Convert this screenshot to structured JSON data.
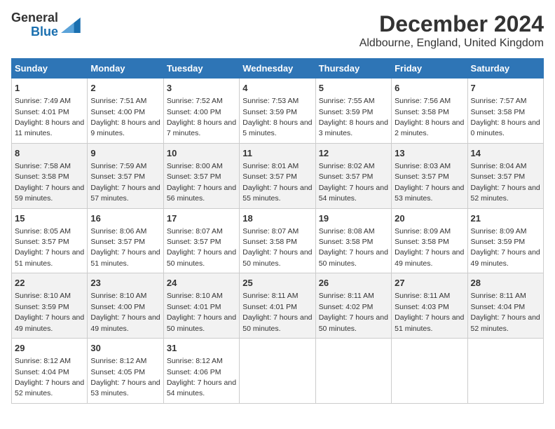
{
  "logo": {
    "general": "General",
    "blue": "Blue"
  },
  "title": "December 2024",
  "subtitle": "Aldbourne, England, United Kingdom",
  "days_of_week": [
    "Sunday",
    "Monday",
    "Tuesday",
    "Wednesday",
    "Thursday",
    "Friday",
    "Saturday"
  ],
  "weeks": [
    [
      {
        "day": "1",
        "sunrise": "7:49 AM",
        "sunset": "4:01 PM",
        "daylight": "8 hours and 11 minutes."
      },
      {
        "day": "2",
        "sunrise": "7:51 AM",
        "sunset": "4:00 PM",
        "daylight": "8 hours and 9 minutes."
      },
      {
        "day": "3",
        "sunrise": "7:52 AM",
        "sunset": "4:00 PM",
        "daylight": "8 hours and 7 minutes."
      },
      {
        "day": "4",
        "sunrise": "7:53 AM",
        "sunset": "3:59 PM",
        "daylight": "8 hours and 5 minutes."
      },
      {
        "day": "5",
        "sunrise": "7:55 AM",
        "sunset": "3:59 PM",
        "daylight": "8 hours and 3 minutes."
      },
      {
        "day": "6",
        "sunrise": "7:56 AM",
        "sunset": "3:58 PM",
        "daylight": "8 hours and 2 minutes."
      },
      {
        "day": "7",
        "sunrise": "7:57 AM",
        "sunset": "3:58 PM",
        "daylight": "8 hours and 0 minutes."
      }
    ],
    [
      {
        "day": "8",
        "sunrise": "7:58 AM",
        "sunset": "3:58 PM",
        "daylight": "7 hours and 59 minutes."
      },
      {
        "day": "9",
        "sunrise": "7:59 AM",
        "sunset": "3:57 PM",
        "daylight": "7 hours and 57 minutes."
      },
      {
        "day": "10",
        "sunrise": "8:00 AM",
        "sunset": "3:57 PM",
        "daylight": "7 hours and 56 minutes."
      },
      {
        "day": "11",
        "sunrise": "8:01 AM",
        "sunset": "3:57 PM",
        "daylight": "7 hours and 55 minutes."
      },
      {
        "day": "12",
        "sunrise": "8:02 AM",
        "sunset": "3:57 PM",
        "daylight": "7 hours and 54 minutes."
      },
      {
        "day": "13",
        "sunrise": "8:03 AM",
        "sunset": "3:57 PM",
        "daylight": "7 hours and 53 minutes."
      },
      {
        "day": "14",
        "sunrise": "8:04 AM",
        "sunset": "3:57 PM",
        "daylight": "7 hours and 52 minutes."
      }
    ],
    [
      {
        "day": "15",
        "sunrise": "8:05 AM",
        "sunset": "3:57 PM",
        "daylight": "7 hours and 51 minutes."
      },
      {
        "day": "16",
        "sunrise": "8:06 AM",
        "sunset": "3:57 PM",
        "daylight": "7 hours and 51 minutes."
      },
      {
        "day": "17",
        "sunrise": "8:07 AM",
        "sunset": "3:57 PM",
        "daylight": "7 hours and 50 minutes."
      },
      {
        "day": "18",
        "sunrise": "8:07 AM",
        "sunset": "3:58 PM",
        "daylight": "7 hours and 50 minutes."
      },
      {
        "day": "19",
        "sunrise": "8:08 AM",
        "sunset": "3:58 PM",
        "daylight": "7 hours and 50 minutes."
      },
      {
        "day": "20",
        "sunrise": "8:09 AM",
        "sunset": "3:58 PM",
        "daylight": "7 hours and 49 minutes."
      },
      {
        "day": "21",
        "sunrise": "8:09 AM",
        "sunset": "3:59 PM",
        "daylight": "7 hours and 49 minutes."
      }
    ],
    [
      {
        "day": "22",
        "sunrise": "8:10 AM",
        "sunset": "3:59 PM",
        "daylight": "7 hours and 49 minutes."
      },
      {
        "day": "23",
        "sunrise": "8:10 AM",
        "sunset": "4:00 PM",
        "daylight": "7 hours and 49 minutes."
      },
      {
        "day": "24",
        "sunrise": "8:10 AM",
        "sunset": "4:01 PM",
        "daylight": "7 hours and 50 minutes."
      },
      {
        "day": "25",
        "sunrise": "8:11 AM",
        "sunset": "4:01 PM",
        "daylight": "7 hours and 50 minutes."
      },
      {
        "day": "26",
        "sunrise": "8:11 AM",
        "sunset": "4:02 PM",
        "daylight": "7 hours and 50 minutes."
      },
      {
        "day": "27",
        "sunrise": "8:11 AM",
        "sunset": "4:03 PM",
        "daylight": "7 hours and 51 minutes."
      },
      {
        "day": "28",
        "sunrise": "8:11 AM",
        "sunset": "4:04 PM",
        "daylight": "7 hours and 52 minutes."
      }
    ],
    [
      {
        "day": "29",
        "sunrise": "8:12 AM",
        "sunset": "4:04 PM",
        "daylight": "7 hours and 52 minutes."
      },
      {
        "day": "30",
        "sunrise": "8:12 AM",
        "sunset": "4:05 PM",
        "daylight": "7 hours and 53 minutes."
      },
      {
        "day": "31",
        "sunrise": "8:12 AM",
        "sunset": "4:06 PM",
        "daylight": "7 hours and 54 minutes."
      },
      null,
      null,
      null,
      null
    ]
  ]
}
